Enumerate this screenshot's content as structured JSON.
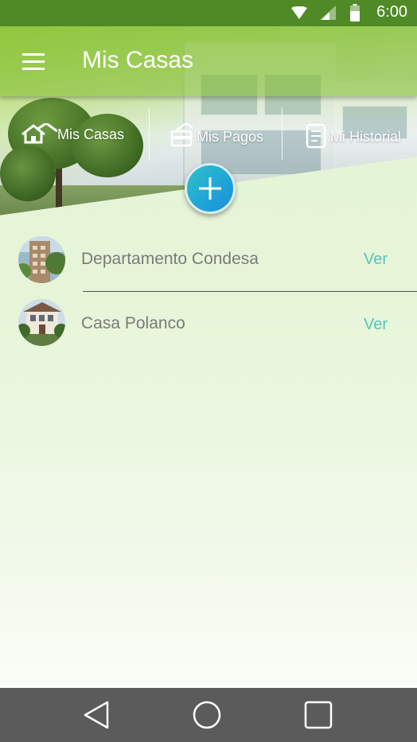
{
  "status_bar": {
    "time": "6:00",
    "icons": [
      "wifi-icon",
      "signal-icon",
      "battery-icon"
    ]
  },
  "toolbar": {
    "title": "Mis Casas",
    "menu_icon": "hamburger-menu-icon"
  },
  "tabs": [
    {
      "label": "Mis Casas",
      "icon": "houses-icon"
    },
    {
      "label": "Mis Pagos",
      "icon": "payment-card-icon"
    },
    {
      "label": "Mi Historial",
      "icon": "document-history-icon"
    }
  ],
  "fab": {
    "icon": "plus-icon"
  },
  "list": {
    "items": [
      {
        "name": "Departamento Condesa",
        "action": "Ver",
        "avatar": "apartment-building-photo"
      },
      {
        "name": "Casa Polanco",
        "action": "Ver",
        "avatar": "house-photo"
      }
    ]
  },
  "nav_bar": {
    "icons": [
      "back-triangle-icon",
      "home-circle-icon",
      "recents-square-icon"
    ]
  },
  "colors": {
    "status_bar": "#4f8a26",
    "accent_teal": "#57c3bd",
    "fab_blue": "#21a6d8",
    "nav_bar": "#5b5b5b"
  }
}
